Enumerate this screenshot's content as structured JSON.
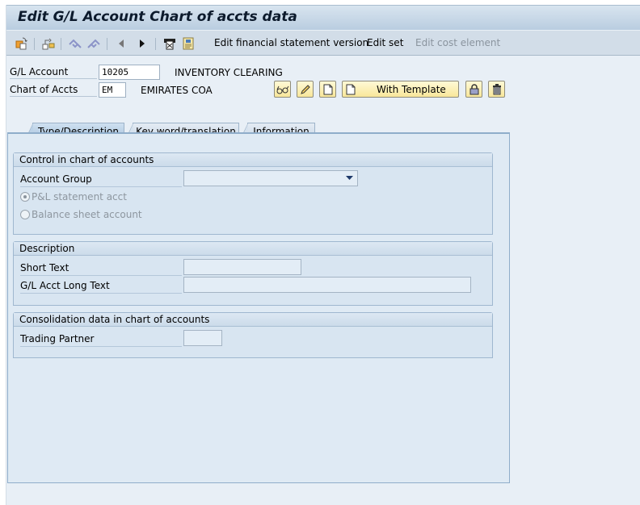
{
  "window": {
    "title": "Edit G/L Account Chart of accts data"
  },
  "toolbar": {
    "icons": [
      {
        "name": "other-object-icon"
      },
      {
        "name": "hierarchy-switch-icon"
      },
      {
        "name": "previous-entry-icon"
      },
      {
        "name": "next-entry-icon"
      },
      {
        "name": "previous-item-icon"
      },
      {
        "name": "next-item-icon"
      },
      {
        "name": "print-icon"
      },
      {
        "name": "display-document-icon"
      }
    ],
    "edit_fs_version_label": "Edit financial statement version",
    "edit_set_label": "Edit set",
    "edit_cost_element_label": "Edit cost element"
  },
  "header": {
    "gl_account_label": "G/L Account",
    "gl_account_value": "10205",
    "gl_account_desc": "INVENTORY CLEARING",
    "chart_label": "Chart of Accts",
    "chart_value": "EM",
    "chart_desc": "EMIRATES COA",
    "with_template_label": "With Template"
  },
  "tabs": [
    {
      "label": "Type/Description",
      "active": true
    },
    {
      "label": "Key word/translation",
      "active": false
    },
    {
      "label": "Information",
      "active": false
    }
  ],
  "groups": {
    "control": {
      "title": "Control in chart of accounts",
      "account_group_label": "Account Group",
      "account_group_value": "",
      "pl_label": "P&L statement acct",
      "pl_selected": true,
      "bs_label": "Balance sheet account",
      "bs_selected": false
    },
    "description": {
      "title": "Description",
      "short_text_label": "Short Text",
      "short_text_value": "",
      "long_text_label": "G/L Acct Long Text",
      "long_text_value": ""
    },
    "consolidation": {
      "title": "Consolidation data in chart of accounts",
      "trading_partner_label": "Trading Partner",
      "trading_partner_value": ""
    }
  }
}
